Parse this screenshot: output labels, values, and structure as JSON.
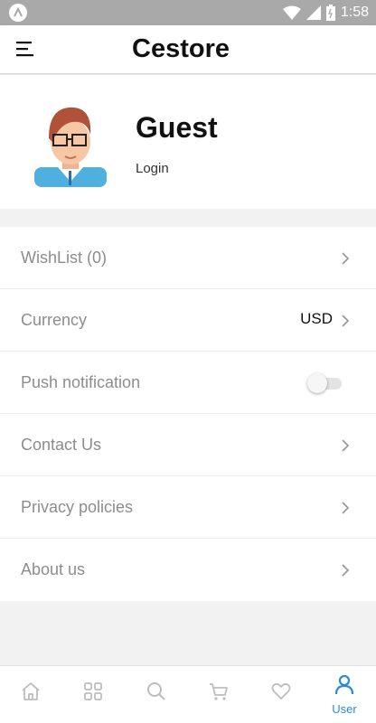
{
  "status_bar": {
    "time": "1:58"
  },
  "app_bar": {
    "title": "Cestore",
    "menu_icon": "menu-icon"
  },
  "profile": {
    "name": "Guest",
    "login_label": "Login",
    "avatar_icon": "user-avatar"
  },
  "settings": {
    "wishlist_label": "WishList (0)",
    "currency_label": "Currency",
    "currency_value": "USD",
    "push_label": "Push notification",
    "push_enabled": false,
    "contact_label": "Contact Us",
    "privacy_label": "Privacy policies",
    "about_label": "About us"
  },
  "bottom_nav": {
    "items": [
      {
        "icon": "home-icon",
        "label": ""
      },
      {
        "icon": "grid-icon",
        "label": ""
      },
      {
        "icon": "search-icon",
        "label": ""
      },
      {
        "icon": "cart-icon",
        "label": ""
      },
      {
        "icon": "heart-icon",
        "label": ""
      },
      {
        "icon": "user-icon",
        "label": "User",
        "active": true
      }
    ]
  },
  "colors": {
    "accent": "#2a8bd8",
    "muted_text": "#8d8d8d",
    "status_bar": "#a9a9a9"
  }
}
